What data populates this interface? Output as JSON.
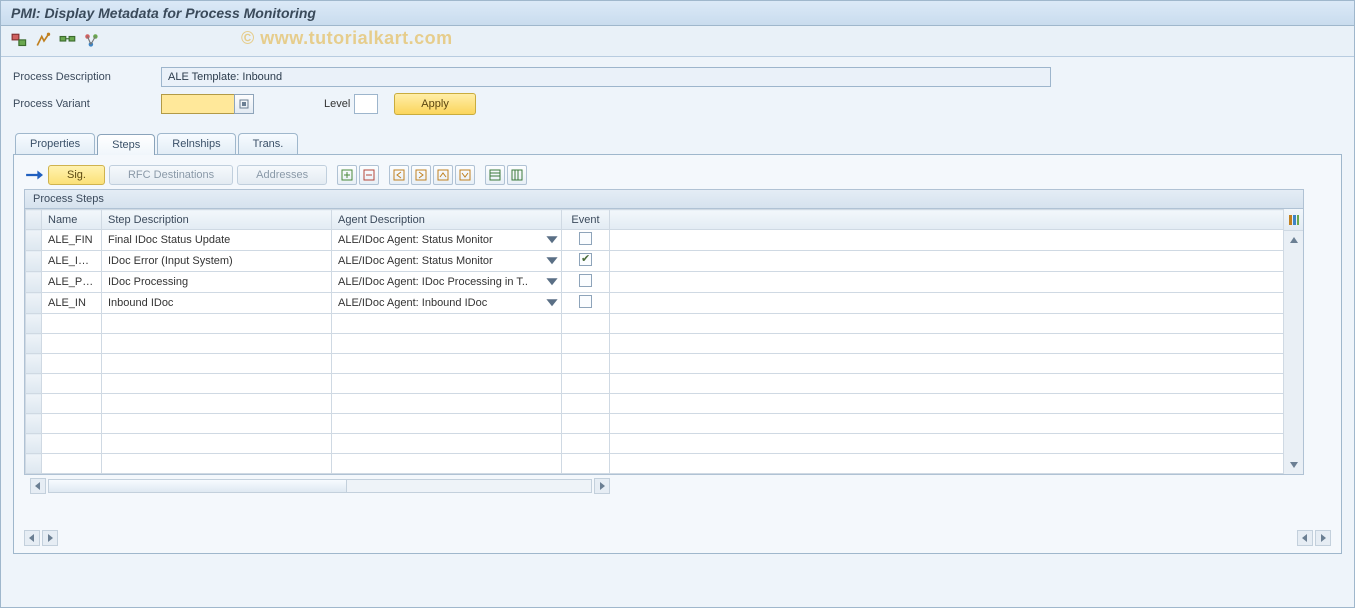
{
  "title": "PMI: Display Metadata for Process Monitoring",
  "watermark": "© www.tutorialkart.com",
  "form": {
    "process_description_label": "Process Description",
    "process_description_value": "ALE Template: Inbound",
    "process_variant_label": "Process Variant",
    "process_variant_value": "",
    "level_label": "Level",
    "level_value": "",
    "apply_label": "Apply"
  },
  "tabs": {
    "properties": "Properties",
    "steps": "Steps",
    "relnships": "Relnships",
    "trans": "Trans.",
    "active": "steps"
  },
  "inner_toolbar": {
    "sig": "Sig.",
    "rfc": "RFC Destinations",
    "addresses": "Addresses"
  },
  "grid": {
    "title": "Process Steps",
    "columns": {
      "name": "Name",
      "step": "Step Description",
      "agent": "Agent Description",
      "event": "Event"
    },
    "rows": [
      {
        "name": "ALE_FIN",
        "step": "Final IDoc Status Update",
        "agent": "ALE/IDoc Agent: Status Monitor",
        "event": false
      },
      {
        "name": "ALE_INST",
        "step": "IDoc Error (Input System)",
        "agent": "ALE/IDoc Agent: Status Monitor",
        "event": true
      },
      {
        "name": "ALE_PROC",
        "step": "IDoc Processing",
        "agent": "ALE/IDoc Agent: IDoc Processing in T..",
        "event": false
      },
      {
        "name": "ALE_IN",
        "step": "Inbound IDoc",
        "agent": "ALE/IDoc Agent: Inbound IDoc",
        "event": false
      }
    ],
    "blank_rows": 8
  }
}
